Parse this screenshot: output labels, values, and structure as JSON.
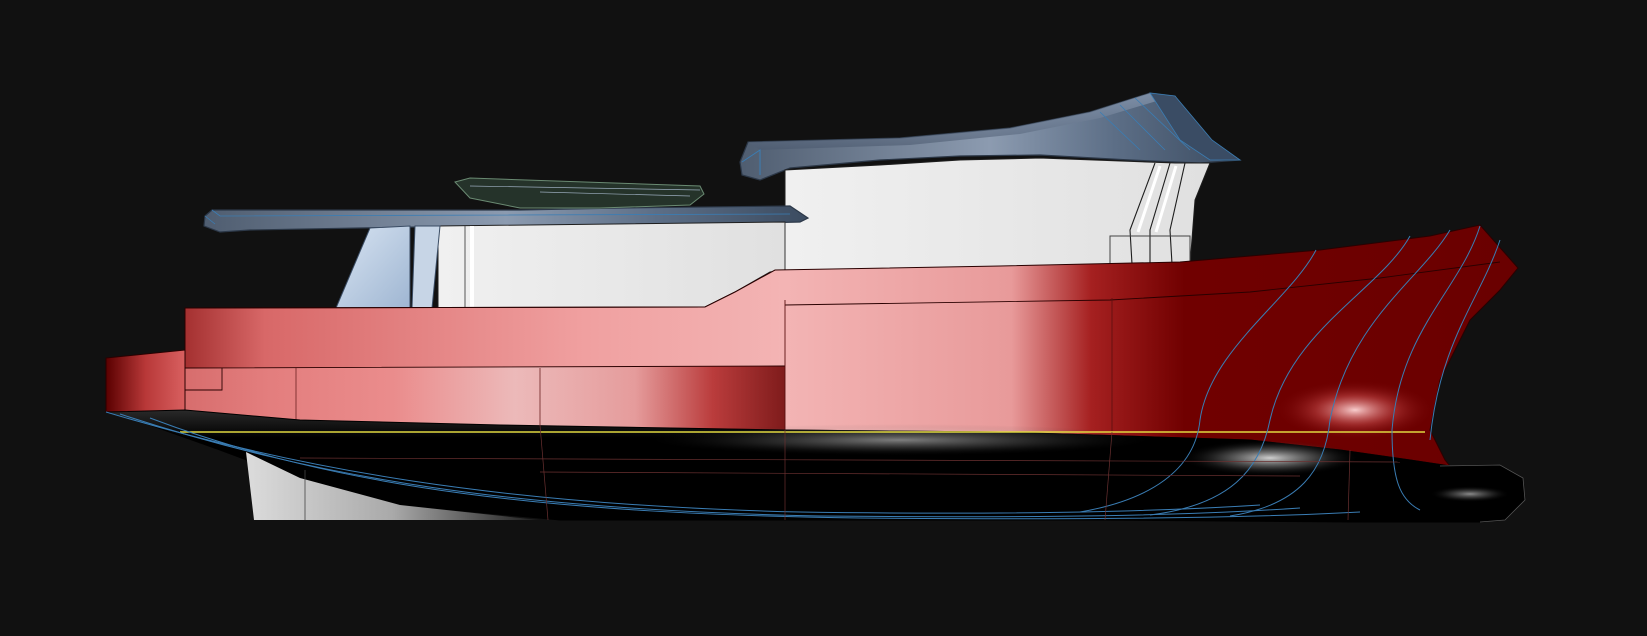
{
  "scene": {
    "background": "#111111",
    "subject": "yacht-side-profile-render",
    "colors": {
      "hull_red_dark": "#6b0000",
      "hull_red_light": "#f2a0a0",
      "hull_red_mid": "#e07070",
      "underbody": "#000000",
      "superstructure_glass": "#e6e6e6",
      "roof_blue_grey": "#5f7088",
      "window_light_blue": "#b8cde6",
      "waterline": "#e0d840",
      "curve_lines": "#3a7db4",
      "tender": "#2a3a2e"
    }
  }
}
